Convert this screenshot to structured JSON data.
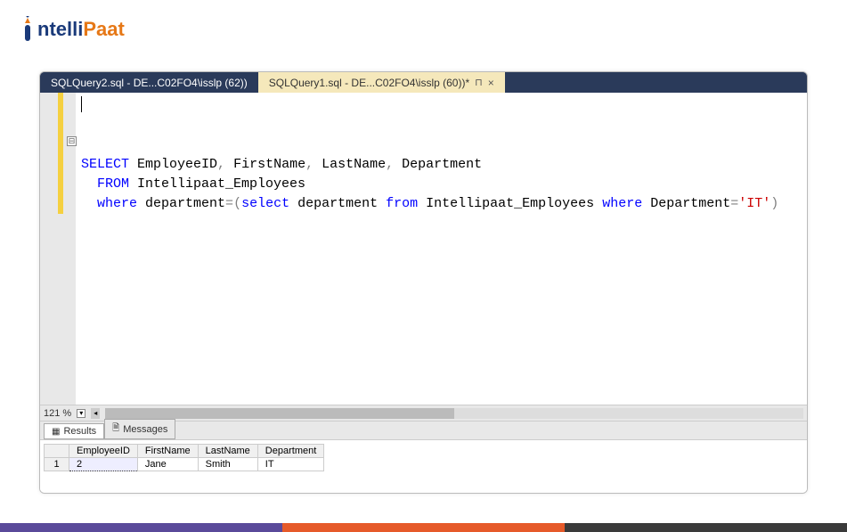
{
  "logo": {
    "part1": "ntelli",
    "part2": "Paat"
  },
  "tabs": {
    "inactive_label": "SQLQuery2.sql - DE...C02FO4\\isslp (62))",
    "active_label": "SQLQuery1.sql - DE...C02FO4\\isslp (60))*",
    "pin_glyph": "⊓",
    "close_glyph": "×"
  },
  "code": {
    "collapse_glyph": "⊟",
    "tokens": {
      "l1_kw": "SELECT",
      "l1_rest": " EmployeeID",
      "l1_c1": ",",
      "l1_p2": " FirstName",
      "l1_c2": ",",
      "l1_p3": " LastName",
      "l1_c3": ",",
      "l1_p4": " Department",
      "l2_kw": "  FROM",
      "l2_rest": " Intellipaat_Employees",
      "l3_kw": "  where",
      "l3_p1": " department",
      "l3_eq1": "=",
      "l3_lp": "(",
      "l3_sel": "select",
      "l3_p2": " department ",
      "l3_from": "from",
      "l3_p3": " Intellipaat_Employees ",
      "l3_where": "where",
      "l3_p4": " Department",
      "l3_eq2": "=",
      "l3_str": "'IT'",
      "l3_rp": ")"
    }
  },
  "zoom": {
    "level": "121 %",
    "arrow": "▾",
    "scroll_arrow": "◂"
  },
  "results": {
    "tab_results": "Results",
    "tab_messages": "Messages",
    "grid_icon": "▦",
    "msg_icon": "🗎",
    "headers": [
      "EmployeeID",
      "FirstName",
      "LastName",
      "Department"
    ],
    "rows": [
      {
        "n": "1",
        "cells": [
          "2",
          "Jane",
          "Smith",
          "IT"
        ]
      }
    ]
  }
}
